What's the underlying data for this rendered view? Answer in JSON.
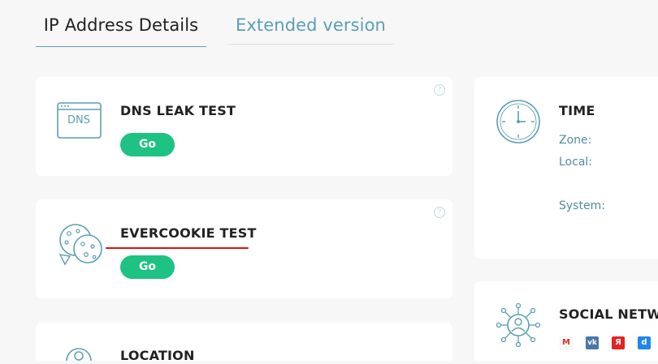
{
  "tabs": [
    {
      "label": "IP Address Details"
    },
    {
      "label": "Extended version"
    }
  ],
  "cards": {
    "dns": {
      "title": "DNS LEAK TEST",
      "icon_text": "DNS",
      "button": "Go",
      "help": "?"
    },
    "evercookie": {
      "title": "EVERCOOKIE TEST",
      "button": "Go",
      "help": "?"
    },
    "location": {
      "title": "LOCATION"
    },
    "time": {
      "title": "TIME",
      "zone_label": "Zone:",
      "local_label": "Local:",
      "system_label": "System:"
    },
    "social": {
      "title": "SOCIAL NETWO",
      "icons": [
        {
          "name": "gmail",
          "glyph": "M",
          "color": "#ffffff"
        },
        {
          "name": "vk",
          "glyph": "vk",
          "color": "#4a76a8"
        },
        {
          "name": "yandex",
          "glyph": "Я",
          "color": "#e42424"
        },
        {
          "name": "odnoklassniki",
          "glyph": "d",
          "color": "#1e88e5"
        }
      ]
    }
  },
  "colors": {
    "accent": "#5aa0b4",
    "button": "#1ec283",
    "underline": "#e01010"
  }
}
